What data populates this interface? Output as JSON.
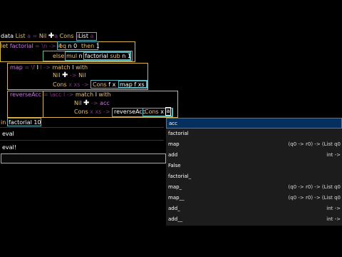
{
  "code": {
    "l1": {
      "data": "data",
      "name": "List",
      "a": "a",
      "eq": "=",
      "nil": "Nil",
      "cons": "Cons",
      "a2": "a",
      "list": "List",
      "a3": "a"
    },
    "l2": {
      "let": "let",
      "name": "factorial",
      "eq": "=",
      "lam": "\\n ->",
      "if": "if",
      "eqfn": "eq",
      "n": "n",
      "zero": "0",
      "then": "then",
      "one": "1"
    },
    "l3": {
      "else": "else",
      "mul": "mul",
      "n": "n",
      "factorial": "factorial",
      "sub": "sub",
      "n2": "n",
      "one": "1"
    },
    "l4": {
      "name": "map",
      "eq": "=",
      "lam": "\\f",
      "lam2": "l ->",
      "match": "match",
      "l": "l",
      "with": "with"
    },
    "l5": {
      "nil": "Nil",
      "arrow": "->",
      "nil2": "Nil"
    },
    "l6": {
      "cons": "Cons",
      "x": "x",
      "xs": "xs",
      "arrow": "->",
      "cons2": "Cons",
      "f": "f",
      "x2": "x",
      "map": "map",
      "f2": "f",
      "xs2": "xs"
    },
    "l7": {
      "name": "reverseAcc",
      "eq": "=",
      "lam": "\\acc l ->",
      "match": "match",
      "l": "l",
      "with": "with"
    },
    "l8": {
      "nil": "Nil",
      "arrow": "->",
      "acc": "acc"
    },
    "l9": {
      "cons": "Cons",
      "x": "x",
      "xs": "xs",
      "arrow": "->",
      "rev": "reverseAcc",
      "cons2": "Cons",
      "x2": "x",
      "a": "a"
    },
    "l10": {
      "in": "in",
      "factorial": "factorial",
      "ten": "10"
    }
  },
  "repl": {
    "line1": "eval",
    "line2": "eval!",
    "input_value": ""
  },
  "autocomplete": [
    {
      "label": "acc",
      "type": "",
      "selected": true
    },
    {
      "label": "factorial",
      "type": ""
    },
    {
      "label": "map",
      "type": "(q0 -> r0) -> (List q0"
    },
    {
      "label": "add",
      "type": "int ->"
    },
    {
      "label": "False",
      "type": ""
    },
    {
      "label": "factorial_",
      "type": ""
    },
    {
      "label": "map_",
      "type": "(q0 -> r0) -> (List q0"
    },
    {
      "label": "map__",
      "type": "(q0 -> r0) -> (List q0"
    },
    {
      "label": "add_",
      "type": "int ->"
    },
    {
      "label": "add__",
      "type": "int ->"
    }
  ]
}
